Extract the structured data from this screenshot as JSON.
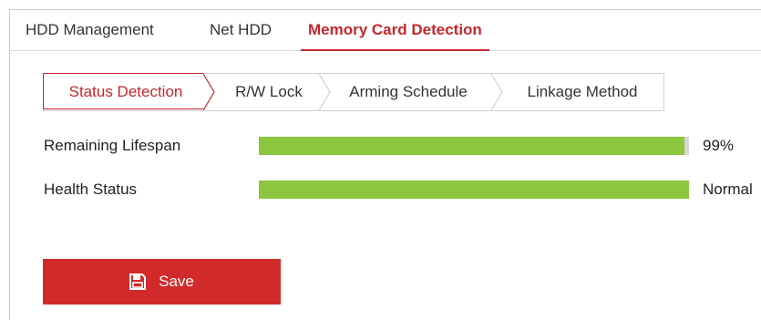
{
  "top_tabs": [
    {
      "label": "HDD Management"
    },
    {
      "label": "Net HDD"
    },
    {
      "label": "Memory Card Detection"
    }
  ],
  "sub_tabs": [
    {
      "label": "Status Detection"
    },
    {
      "label": "R/W Lock"
    },
    {
      "label": "Arming Schedule"
    },
    {
      "label": "Linkage Method"
    }
  ],
  "fields": {
    "remaining_lifespan": {
      "label": "Remaining Lifespan",
      "value": "99%",
      "fill_percent": 99
    },
    "health_status": {
      "label": "Health Status",
      "value": "Normal",
      "fill_percent": 100
    }
  },
  "save": {
    "label": "Save",
    "icon": "save-icon"
  },
  "colors": {
    "accent": "#c8262b",
    "progress": "#8cc63f",
    "button": "#d22a2a"
  }
}
